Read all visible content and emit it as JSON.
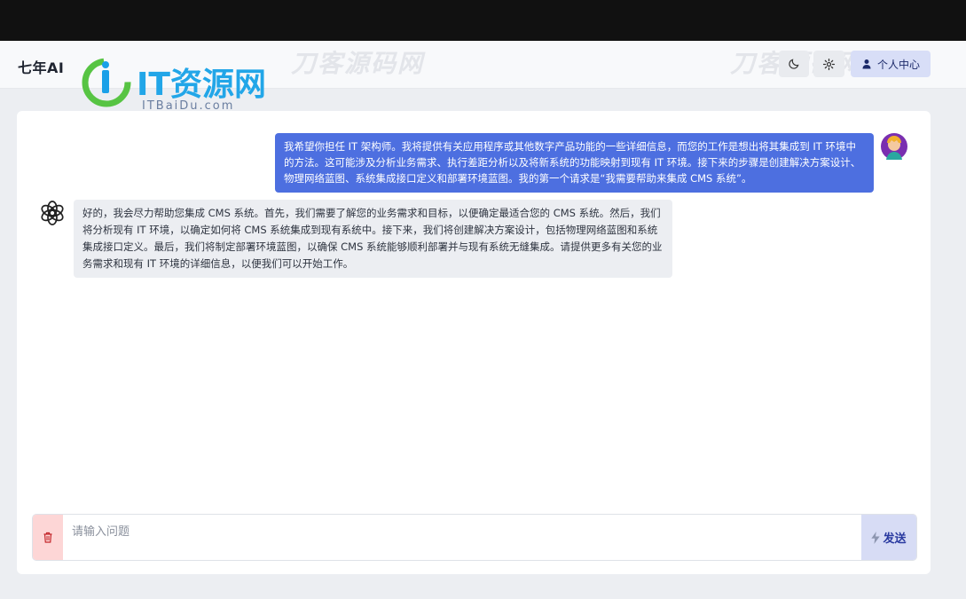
{
  "header": {
    "app_title": "七年AI",
    "profile_label": "个人中心",
    "watermark_text": "刀客源码网"
  },
  "logo": {
    "main_text": "IT资源网",
    "sub_text": "ITBaiDu.com"
  },
  "icons": {
    "theme": "moon-icon",
    "settings": "gear-icon",
    "profile": "user-icon",
    "clear": "trash-icon",
    "send": "lightning-icon",
    "bot_avatar": "openai-logo-icon"
  },
  "chat": {
    "user_message": "我希望你担任 IT 架构师。我将提供有关应用程序或其他数字产品功能的一些详细信息，而您的工作是想出将其集成到 IT 环境中的方法。这可能涉及分析业务需求、执行差距分析以及将新系统的功能映射到现有 IT 环境。接下来的步骤是创建解决方案设计、物理网络蓝图、系统集成接口定义和部署环境蓝图。我的第一个请求是“我需要帮助来集成 CMS 系统”。",
    "bot_message": "好的，我会尽力帮助您集成 CMS 系统。首先，我们需要了解您的业务需求和目标，以便确定最适合您的 CMS 系统。然后，我们将分析现有 IT 环境，以确定如何将 CMS 系统集成到现有系统中。接下来，我们将创建解决方案设计，包括物理网络蓝图和系统集成接口定义。最后，我们将制定部署环境蓝图，以确保 CMS 系统能够顺利部署并与现有系统无缝集成。请提供更多有关您的业务需求和现有 IT 环境的详细信息，以便我们可以开始工作。"
  },
  "input": {
    "placeholder": "请输入问题",
    "value": "",
    "send_label": "发送"
  },
  "colors": {
    "user_bubble": "#4d6fe0",
    "bot_bubble": "#eceef2",
    "profile_button": "#d8def7",
    "clear_button": "#fdd6d6",
    "send_button": "#d7dcf5"
  }
}
